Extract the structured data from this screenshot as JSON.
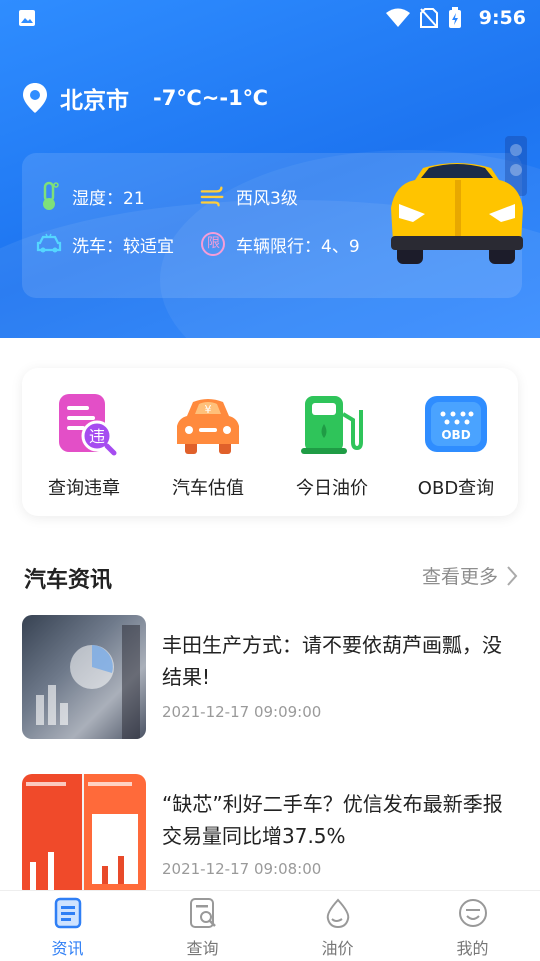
{
  "statusbar": {
    "time": "9:56"
  },
  "location": {
    "city": "北京市",
    "temperature": "-7℃~-1℃"
  },
  "weather": {
    "humidity": "湿度：21",
    "wind": "西风3级",
    "car_wash": "洗车：较适宜",
    "restriction_badge": "限",
    "restriction": "车辆限行：4、9"
  },
  "services": [
    {
      "label": "查询违章",
      "icon": "violation-query-icon",
      "badge": "违"
    },
    {
      "label": "汽车估值",
      "icon": "car-valuation-icon",
      "badge": "¥"
    },
    {
      "label": "今日油价",
      "icon": "fuel-price-icon"
    },
    {
      "label": "OBD查询",
      "icon": "obd-query-icon",
      "badge": "OBD"
    }
  ],
  "news": {
    "title": "汽车资讯",
    "more": "查看更多",
    "items": [
      {
        "title": "丰田生产方式：请不要依葫芦画瓢，没结果!",
        "date": "2021-12-17 09:09:00"
      },
      {
        "title": "“缺芯”利好二手车？优信发布最新季报 交易量同比增37.5%",
        "date": "2021-12-17 09:08:00"
      }
    ]
  },
  "tabs": [
    {
      "label": "资讯",
      "icon": "news-icon",
      "active": true
    },
    {
      "label": "查询",
      "icon": "query-icon",
      "active": false
    },
    {
      "label": "油价",
      "icon": "oil-drop-icon",
      "active": false
    },
    {
      "label": "我的",
      "icon": "profile-icon",
      "active": false
    }
  ],
  "colors": {
    "header": "#1d74f0",
    "accent": "#2f7ff5",
    "car_yellow": "#ffc400"
  }
}
